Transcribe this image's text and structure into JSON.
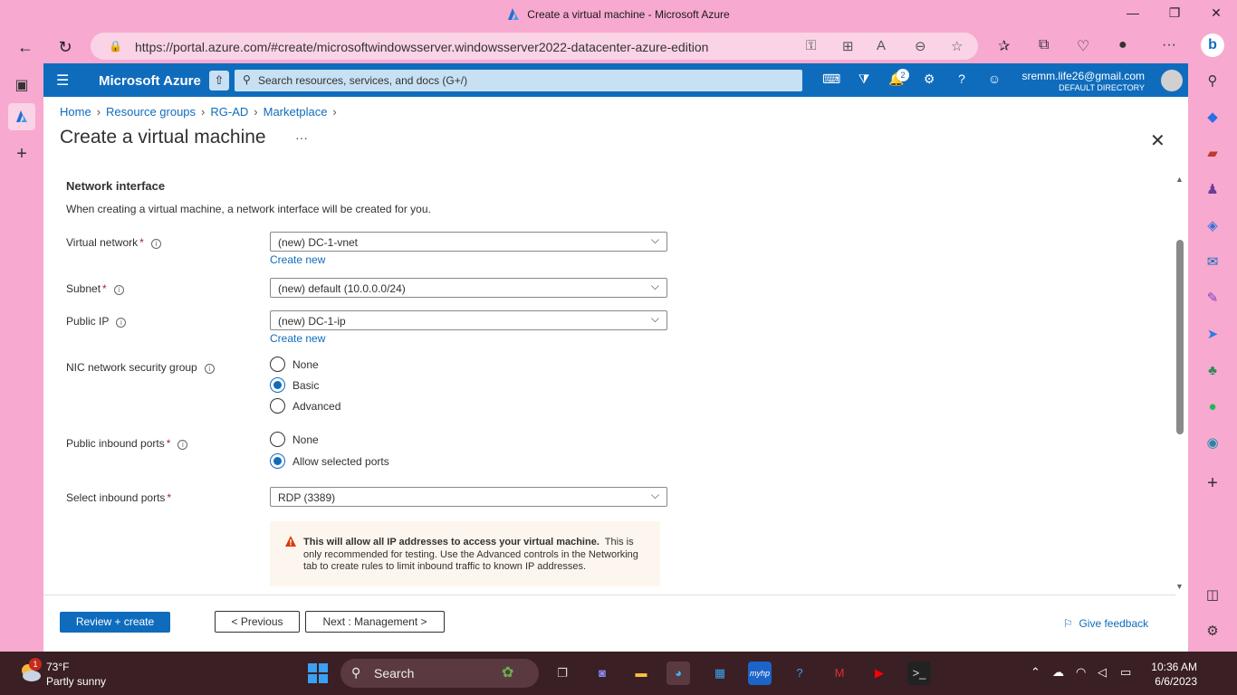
{
  "browser": {
    "window_title": "Create a virtual machine - Microsoft Azure",
    "url": "https://portal.azure.com/#create/microsoftwindowsserver.windowsserver2022-datacenter-azure-edition"
  },
  "azure_bar": {
    "brand": "Microsoft Azure",
    "search_placeholder": "Search resources, services, and docs (G+/)",
    "notification_count": "2",
    "account_email": "sremm.life26@gmail.com",
    "account_directory": "DEFAULT DIRECTORY"
  },
  "breadcrumb": [
    "Home",
    "Resource groups",
    "RG-AD",
    "Marketplace"
  ],
  "page": {
    "title": "Create a virtual machine",
    "more": "···"
  },
  "section": {
    "heading": "Network interface",
    "description": "When creating a virtual machine, a network interface will be created for you."
  },
  "fields": {
    "virtual_network": {
      "label": "Virtual network",
      "value": "(new) DC-1-vnet",
      "link": "Create new"
    },
    "subnet": {
      "label": "Subnet",
      "value": "(new) default (10.0.0.0/24)"
    },
    "public_ip": {
      "label": "Public IP",
      "value": "(new) DC-1-ip",
      "link": "Create new"
    },
    "nic_nsg": {
      "label": "NIC network security group",
      "options": [
        "None",
        "Basic",
        "Advanced"
      ],
      "selected": "Basic"
    },
    "public_inbound_ports": {
      "label": "Public inbound ports",
      "options": [
        "None",
        "Allow selected ports"
      ],
      "selected": "Allow selected ports"
    },
    "select_inbound_ports": {
      "label": "Select inbound ports",
      "value": "RDP (3389)"
    }
  },
  "warning": {
    "bold": "This will allow all IP addresses to access your virtual machine.",
    "rest": "This is only recommended for testing.  Use the Advanced controls in the Networking tab to create rules to limit inbound traffic to known IP addresses."
  },
  "footer": {
    "review_create": "Review + create",
    "previous": "< Previous",
    "next": "Next : Management >",
    "feedback": "Give feedback"
  },
  "taskbar": {
    "weather_badge": "1",
    "temperature": "73°F",
    "condition": "Partly sunny",
    "search_label": "Search",
    "time": "10:36 AM",
    "date": "6/6/2023"
  },
  "colors": {
    "azure_blue": "#0f6cbd",
    "browser_frame": "#f7a9cf",
    "required": "#a4262c",
    "warning_bg": "#fdf6ee",
    "taskbar": "#3a1f24"
  }
}
